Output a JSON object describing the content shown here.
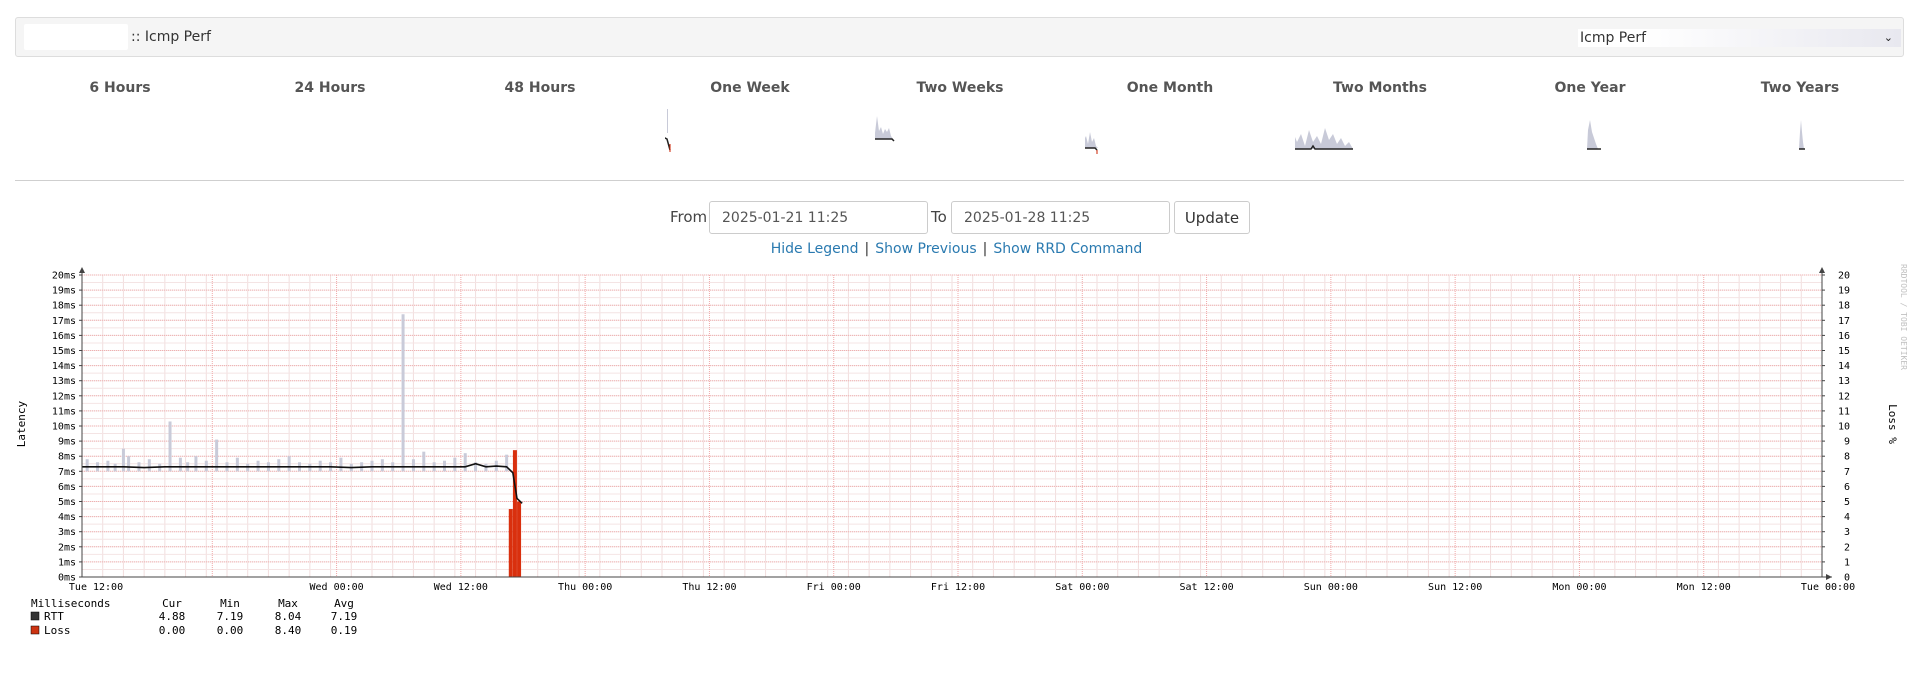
{
  "header": {
    "title": ":: Icmp Perf",
    "graph_select_value": "Icmp Perf"
  },
  "periods": [
    {
      "label": "6 Hours"
    },
    {
      "label": "24 Hours"
    },
    {
      "label": "48 Hours"
    },
    {
      "label": "One Week"
    },
    {
      "label": "Two Weeks"
    },
    {
      "label": "One Month"
    },
    {
      "label": "Two Months"
    },
    {
      "label": "One Year"
    },
    {
      "label": "Two Years"
    }
  ],
  "range": {
    "from_label": "From",
    "from_value": "2025-01-21 11:25",
    "to_label": "To",
    "to_value": "2025-01-28 11:25",
    "update_label": "Update"
  },
  "links": {
    "hide_legend": "Hide Legend",
    "show_previous": "Show Previous",
    "show_rrd_command": "Show RRD Command"
  },
  "chart_data": {
    "type": "line",
    "ylabel": "Latency",
    "y2label": "Loss %",
    "watermark": "RRDTOOL / TOBI OETIKER",
    "ylim": [
      0,
      20
    ],
    "y2lim": [
      0,
      20
    ],
    "y_ticks": [
      "0ms",
      "1ms",
      "2ms",
      "3ms",
      "4ms",
      "5ms",
      "6ms",
      "7ms",
      "8ms",
      "9ms",
      "10ms",
      "11ms",
      "12ms",
      "13ms",
      "14ms",
      "15ms",
      "16ms",
      "17ms",
      "18ms",
      "19ms",
      "20ms"
    ],
    "y2_ticks": [
      "0",
      "1",
      "2",
      "3",
      "4",
      "5",
      "6",
      "7",
      "8",
      "9",
      "10",
      "11",
      "12",
      "13",
      "14",
      "15",
      "16",
      "17",
      "18",
      "19",
      "20"
    ],
    "x_tick_labels": [
      "Tue 12:00",
      "Wed 00:00",
      "Wed 12:00",
      "Thu 00:00",
      "Thu 12:00",
      "Fri 00:00",
      "Fri 12:00",
      "Sat 00:00",
      "Sat 12:00",
      "Sun 00:00",
      "Sun 12:00",
      "Mon 00:00",
      "Mon 12:00",
      "Tue 00:00"
    ],
    "x_tick_hours": [
      12.58,
      24.58,
      36.58,
      48.58,
      60.58,
      72.58,
      84.58,
      96.58,
      108.58,
      120.58,
      132.58,
      144.58,
      156.58,
      168.58
    ],
    "x_range_hours": [
      0,
      168
    ],
    "rtt_hours": [
      0,
      2,
      4,
      6,
      8,
      10,
      12,
      14,
      16,
      18,
      20,
      22,
      24,
      26,
      28,
      30,
      32,
      34,
      36,
      37,
      38,
      39,
      40,
      41,
      41.6,
      42,
      42.5
    ],
    "rtt_ms": [
      7.3,
      7.3,
      7.3,
      7.25,
      7.3,
      7.3,
      7.3,
      7.3,
      7.3,
      7.3,
      7.3,
      7.3,
      7.3,
      7.25,
      7.3,
      7.3,
      7.3,
      7.3,
      7.3,
      7.3,
      7.5,
      7.3,
      7.35,
      7.3,
      6.9,
      5.2,
      4.88
    ],
    "spike_hours": [
      0.5,
      1.5,
      2.5,
      3.2,
      4.0,
      4.5,
      5.5,
      6.5,
      7.5,
      8.5,
      9.5,
      10.2,
      11.0,
      12.0,
      13.0,
      14.0,
      15.0,
      16.0,
      17.0,
      18.0,
      19.0,
      20.0,
      21.0,
      22.0,
      23.0,
      24.0,
      25.0,
      26.0,
      27.0,
      28.0,
      29.0,
      30.0,
      31.0,
      32.0,
      33.0,
      34.0,
      35.0,
      36.0,
      37.0,
      38.0,
      39.0,
      40.0,
      41.0,
      41.8
    ],
    "spike_ms": [
      7.8,
      7.6,
      7.7,
      7.5,
      8.5,
      8.0,
      7.6,
      7.8,
      7.5,
      10.3,
      7.9,
      7.6,
      8.0,
      7.7,
      9.1,
      7.6,
      7.9,
      7.5,
      7.7,
      7.6,
      7.8,
      8.0,
      7.6,
      7.5,
      7.7,
      7.6,
      7.9,
      7.5,
      7.6,
      7.7,
      7.8,
      7.6,
      17.4,
      7.8,
      8.3,
      7.6,
      7.7,
      7.9,
      8.2,
      7.6,
      7.5,
      7.7,
      8.1,
      8.3
    ],
    "loss_hours": [
      41.4,
      41.8,
      42.2
    ],
    "loss_pct": [
      4.5,
      8.4,
      5.0
    ],
    "legend": {
      "header": {
        "name": "Milliseconds",
        "cur": "Cur",
        "min": "Min",
        "max": "Max",
        "avg": "Avg"
      },
      "rows": [
        {
          "name": "RTT",
          "color": "#333333",
          "cur": "4.88",
          "min": "7.19",
          "max": "8.04",
          "avg": "7.19"
        },
        {
          "name": "Loss",
          "color": "#cc3311",
          "cur": "0.00",
          "min": "0.00",
          "max": "8.40",
          "avg": "0.19"
        }
      ]
    }
  }
}
